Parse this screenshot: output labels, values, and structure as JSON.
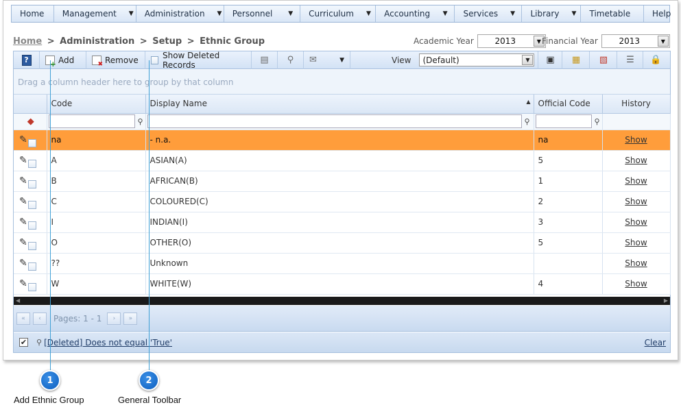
{
  "menu": [
    {
      "label": "Home",
      "dropdown": false
    },
    {
      "label": "Management",
      "dropdown": true
    },
    {
      "label": "Administration",
      "dropdown": true
    },
    {
      "label": "Personnel",
      "dropdown": true
    },
    {
      "label": "Curriculum",
      "dropdown": true
    },
    {
      "label": "Accounting",
      "dropdown": true
    },
    {
      "label": "Services",
      "dropdown": true
    },
    {
      "label": "Library",
      "dropdown": true
    },
    {
      "label": "Timetable",
      "dropdown": false
    },
    {
      "label": "Help",
      "dropdown": false
    }
  ],
  "breadcrumb": {
    "home": "Home",
    "sep": ">",
    "items": [
      "Administration",
      "Setup",
      "Ethnic Group"
    ]
  },
  "academic_year": {
    "label": "Academic Year",
    "value": "2013"
  },
  "financial_year": {
    "label": "Financial Year",
    "value": "2013"
  },
  "toolbar": {
    "help": "?",
    "add": "Add",
    "remove": "Remove",
    "show_deleted": "Show Deleted Records",
    "view_label": "View",
    "view_value": "(Default)"
  },
  "group_hint": "Drag a column header here to group by that column",
  "columns": {
    "code": "Code",
    "display_name": "Display Name",
    "official_code": "Official Code",
    "history": "History"
  },
  "rows": [
    {
      "code": "na",
      "display_name": "- n.a.",
      "official_code": "na",
      "history": "Show",
      "selected": true
    },
    {
      "code": "A",
      "display_name": "ASIAN(A)",
      "official_code": "5",
      "history": "Show"
    },
    {
      "code": "B",
      "display_name": "AFRICAN(B)",
      "official_code": "1",
      "history": "Show"
    },
    {
      "code": "C",
      "display_name": "COLOURED(C)",
      "official_code": "2",
      "history": "Show"
    },
    {
      "code": "I",
      "display_name": "INDIAN(I)",
      "official_code": "3",
      "history": "Show"
    },
    {
      "code": "O",
      "display_name": "OTHER(O)",
      "official_code": "5",
      "history": "Show"
    },
    {
      "code": "??",
      "display_name": "Unknown",
      "official_code": "",
      "history": "Show"
    },
    {
      "code": "W",
      "display_name": "WHITE(W)",
      "official_code": "4",
      "history": "Show"
    }
  ],
  "pager": {
    "text": "Pages: 1 - 1"
  },
  "status": {
    "filter_text": "[Deleted] Does not equal 'True'",
    "clear": "Clear"
  },
  "callouts": [
    {
      "number": "1",
      "label": "Add Ethnic Group"
    },
    {
      "number": "2",
      "label": "General Toolbar"
    }
  ],
  "colors": {
    "selected_row": "#ff9d3b",
    "callout": "#0d5fbf"
  }
}
